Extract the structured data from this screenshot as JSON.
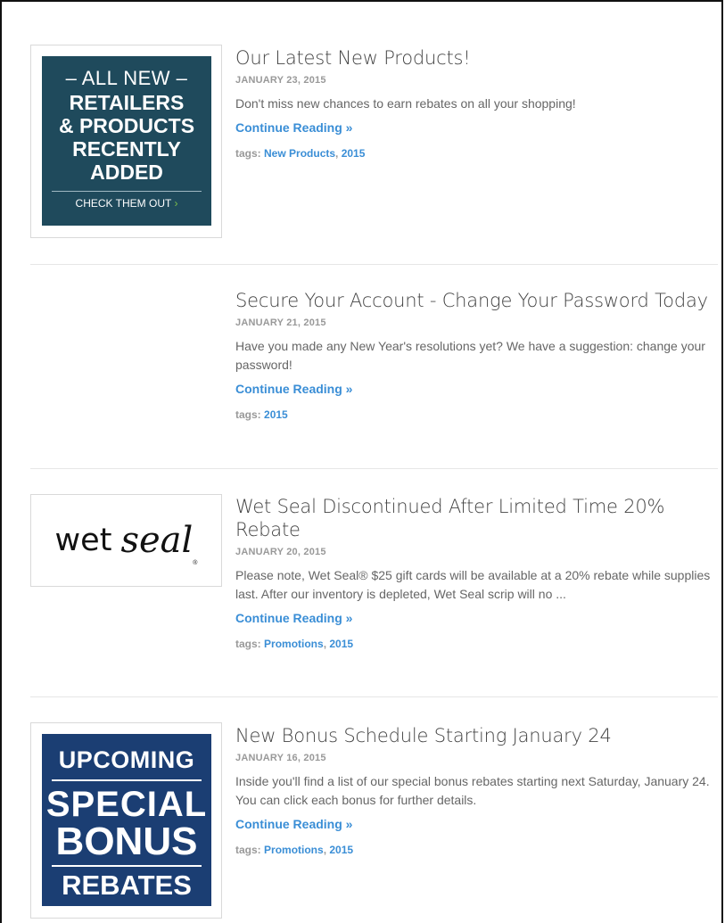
{
  "posts": [
    {
      "title": "Our Latest New Products!",
      "date": "JANUARY 23, 2015",
      "excerpt": "Don't miss new chances to earn rebates on all your shopping!",
      "more": "Continue Reading »",
      "tags_label": "tags:",
      "tags": [
        "New Products",
        "2015"
      ],
      "image": {
        "line1": "– ALL NEW –",
        "line2": "RETAILERS",
        "line3": "& PRODUCTS",
        "line4": "RECENTLY",
        "line5": "ADDED",
        "cta": "CHECK THEM OUT",
        "cta_arrow": "›"
      }
    },
    {
      "title": "Secure Your Account - Change Your Password Today",
      "date": "JANUARY 21, 2015",
      "excerpt": "Have you made any New Year's resolutions yet? We have a suggestion: change your password!",
      "more": "Continue Reading »",
      "tags_label": "tags:",
      "tags": [
        "2015"
      ]
    },
    {
      "title": "Wet Seal Discontinued After Limited Time 20% Rebate",
      "date": "JANUARY 20, 2015",
      "excerpt": "Please note, Wet Seal® $25 gift cards will be available at a 20% rebate while supplies last. After our inventory is depleted, Wet Seal scrip will no ...",
      "more": "Continue Reading »",
      "tags_label": "tags:",
      "tags": [
        "Promotions",
        "2015"
      ],
      "image": {
        "word1": "wet",
        "word2": "seal",
        "mark": "®"
      }
    },
    {
      "title": "New Bonus Schedule Starting January 24",
      "date": "JANUARY 16, 2015",
      "excerpt": "Inside you'll find a list of our special bonus rebates starting next Saturday, January 24. You can click each bonus for further details.",
      "more": "Continue Reading »",
      "tags_label": "tags:",
      "tags": [
        "Promotions",
        "2015"
      ],
      "image": {
        "line1": "UPCOMING",
        "line2": "SPECIAL",
        "line3": "BONUS",
        "line4": "REBATES"
      }
    }
  ],
  "colors": {
    "link": "#3a8ed6",
    "banner1_bg": "#1f4a5c",
    "banner4_bg": "#1b3e73",
    "cta_accent": "#7cc04a"
  }
}
